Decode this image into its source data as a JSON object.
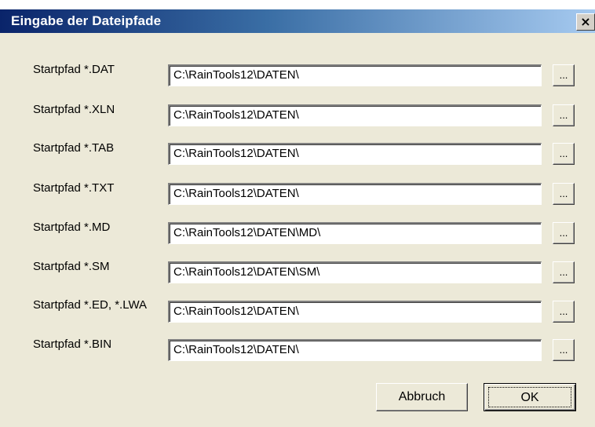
{
  "window": {
    "title": "Eingabe der Dateipfade",
    "close_glyph": "×",
    "colors": {
      "titlebar_start": "#0a246a",
      "titlebar_end": "#a6caf0",
      "dialog_bg": "#ece9d8"
    }
  },
  "rows": [
    {
      "label": "Startpfad *.DAT",
      "value": "C:\\RainTools12\\DATEN\\",
      "browse_label": "..."
    },
    {
      "label": "Startpfad *.XLN",
      "value": "C:\\RainTools12\\DATEN\\",
      "browse_label": "..."
    },
    {
      "label": "Startpfad *.TAB",
      "value": "C:\\RainTools12\\DATEN\\",
      "browse_label": "..."
    },
    {
      "label": "Startpfad *.TXT",
      "value": "C:\\RainTools12\\DATEN\\",
      "browse_label": "..."
    },
    {
      "label": "Startpfad *.MD",
      "value": "C:\\RainTools12\\DATEN\\MD\\",
      "browse_label": "..."
    },
    {
      "label": "Startpfad *.SM",
      "value": "C:\\RainTools12\\DATEN\\SM\\",
      "browse_label": "..."
    },
    {
      "label": "Startpfad *.ED, *.LWA",
      "value": "C:\\RainTools12\\DATEN\\",
      "browse_label": "..."
    },
    {
      "label": "Startpfad *.BIN",
      "value": "C:\\RainTools12\\DATEN\\",
      "browse_label": "..."
    }
  ],
  "buttons": {
    "cancel_label": "Abbruch",
    "ok_label": "OK"
  }
}
